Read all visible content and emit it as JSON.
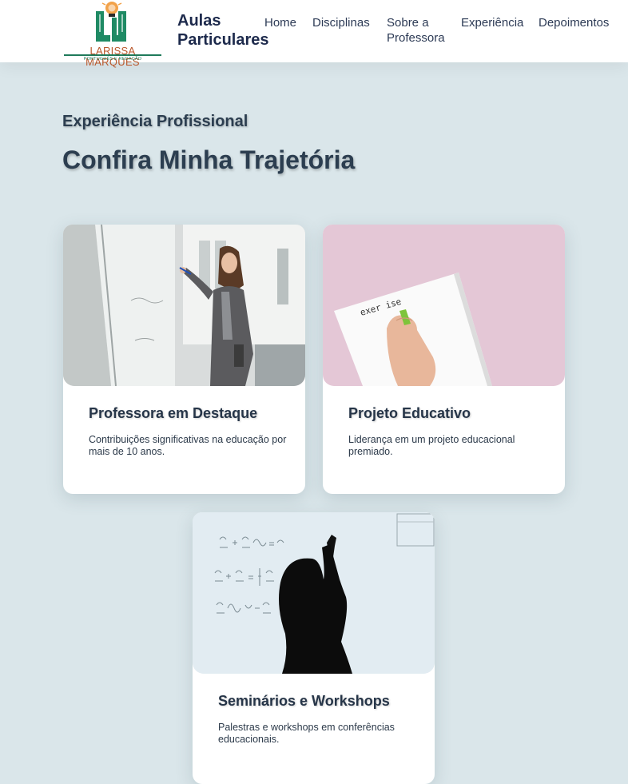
{
  "header": {
    "logo": {
      "name": "LARISSA MARQUES",
      "subtitle": "PORTUGUÊS E REDAÇÃO",
      "icon": "lightbulb-monogram-logo"
    },
    "brand_title": "Aulas Particulares",
    "nav": [
      {
        "label": "Home"
      },
      {
        "label": "Disciplinas"
      },
      {
        "label": "Sobre a Professora"
      },
      {
        "label": "Experiência"
      },
      {
        "label": "Depoimentos"
      }
    ]
  },
  "section": {
    "kicker": "Experiência Profissional",
    "title": "Confira Minha Trajetória"
  },
  "cards": [
    {
      "title": "Professora em Destaque",
      "description": "Contribuições significativas na educação por mais de 10 anos.",
      "image": "teacher-writing-on-whiteboard-photo"
    },
    {
      "title": "Projeto Educativo",
      "description": "Liderança em um projeto educacional premiado.",
      "image": "hand-writing-exercise-notebook-photo",
      "image_text": "exer ise"
    },
    {
      "title": "Seminários e Workshops",
      "description": "Palestras e workshops em conferências educacionais.",
      "image": "silhouette-at-equation-board-photo"
    }
  ],
  "colors": {
    "page_background": "#dae6ea",
    "header_background": "#ffffff",
    "heading": "#2c3e50",
    "brand": "#1d2a4c",
    "logo_orange": "#b8562a",
    "logo_green": "#1f7a5a"
  }
}
